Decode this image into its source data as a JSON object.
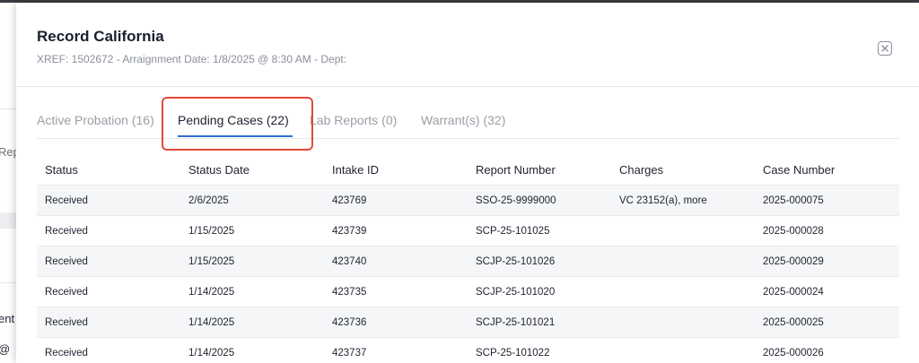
{
  "background": {
    "fragments": [
      "Rep",
      "ent",
      "@"
    ]
  },
  "modal": {
    "title": "Record California",
    "subtitle": "XREF: 1502672 - Arraignment Date: 1/8/2025 @ 8:30 AM - Dept:",
    "close_icon": "close-x-icon"
  },
  "tabs": [
    {
      "label": "Active Probation (16)",
      "active": false
    },
    {
      "label": "Pending Cases (22)",
      "active": true
    },
    {
      "label": "Lab Reports (0)",
      "active": false
    },
    {
      "label": "Warrant(s) (32)",
      "active": false
    }
  ],
  "colors": {
    "accent": "#2f6fd6",
    "highlight": "#e4493b"
  },
  "table": {
    "headers": [
      "Status",
      "Status Date",
      "Intake ID",
      "Report Number",
      "Charges",
      "Case Number"
    ],
    "rows": [
      [
        "Received",
        "2/6/2025",
        "423769",
        "SSO-25-9999000",
        "VC 23152(a), more",
        "2025-000075"
      ],
      [
        "Received",
        "1/15/2025",
        "423739",
        "SCP-25-101025",
        "",
        "2025-000028"
      ],
      [
        "Received",
        "1/15/2025",
        "423740",
        "SCJP-25-101026",
        "",
        "2025-000029"
      ],
      [
        "Received",
        "1/14/2025",
        "423735",
        "SCJP-25-101020",
        "",
        "2025-000024"
      ],
      [
        "Received",
        "1/14/2025",
        "423736",
        "SCJP-25-101021",
        "",
        "2025-000025"
      ],
      [
        "Received",
        "1/14/2025",
        "423737",
        "SCP-25-101022",
        "",
        "2025-000026"
      ]
    ]
  }
}
